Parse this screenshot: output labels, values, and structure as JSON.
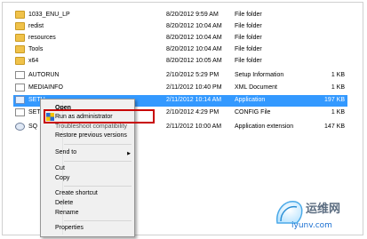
{
  "files": [
    {
      "name": "1033_ENU_LP",
      "date": "8/20/2012 9:59 AM",
      "type": "File folder",
      "size": "",
      "icon": "folder-icon"
    },
    {
      "name": "redist",
      "date": "8/20/2012 10:04 AM",
      "type": "File folder",
      "size": "",
      "icon": "folder-icon"
    },
    {
      "name": "resources",
      "date": "8/20/2012 10:04 AM",
      "type": "File folder",
      "size": "",
      "icon": "folder-icon"
    },
    {
      "name": "Tools",
      "date": "8/20/2012 10:04 AM",
      "type": "File folder",
      "size": "",
      "icon": "folder-icon"
    },
    {
      "name": "x64",
      "date": "8/20/2012 10:05 AM",
      "type": "File folder",
      "size": "",
      "icon": "folder-icon"
    },
    {
      "name": "AUTORUN",
      "date": "2/10/2012 5:29 PM",
      "type": "Setup Information",
      "size": "1 KB",
      "icon": "file-icon"
    },
    {
      "name": "MEDIAINFO",
      "date": "2/11/2012 10:40 PM",
      "type": "XML Document",
      "size": "1 KB",
      "icon": "file-icon"
    },
    {
      "name": "SETU",
      "date": "2/11/2012 10:14 AM",
      "type": "Application",
      "size": "197 KB",
      "icon": "app-icon"
    },
    {
      "name": "SETU",
      "date": "2/10/2012 4:29 PM",
      "type": "CONFIG File",
      "size": "1 KB",
      "icon": "file-icon"
    },
    {
      "name": "SQ",
      "date": "2/11/2012 10:00 AM",
      "type": "Application extension",
      "size": "147 KB",
      "icon": "gear-icon"
    }
  ],
  "context_menu": {
    "open": "Open",
    "run_as_admin": "Run as administrator",
    "troubleshoot": "Troubleshoot compatibility",
    "restore": "Restore previous versions",
    "send_to": "Send to",
    "cut": "Cut",
    "copy": "Copy",
    "create_shortcut": "Create shortcut",
    "delete": "Delete",
    "rename": "Rename",
    "properties": "Properties"
  },
  "watermark": {
    "line1": "运维网",
    "line2": "iyunv.com"
  },
  "colors": {
    "selection": "#3399ff",
    "highlight_border": "#c80000"
  }
}
